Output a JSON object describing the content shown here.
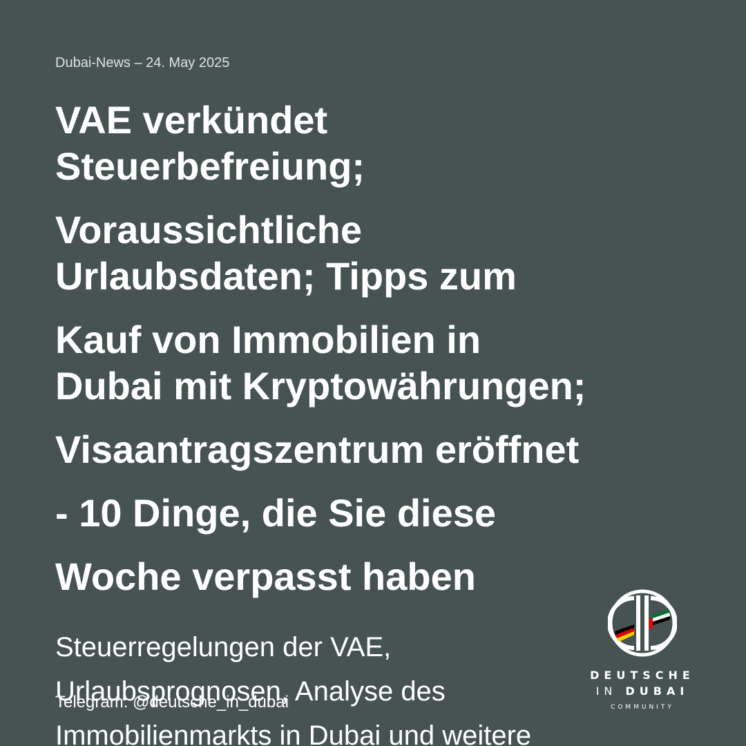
{
  "dateline": "Dubai-News – 24. May 2025",
  "headline": {
    "lines": [
      "VAE verkündet",
      "Steuerbefreiung;",
      "Voraussichtliche",
      "Urlaubsdaten; Tipps zum",
      "Kauf von Immobilien in",
      "Dubai mit Kryptowährungen;",
      "Visaantragszentrum eröffnet",
      "- 10 Dinge, die Sie diese",
      "Woche verpasst haben"
    ]
  },
  "subtitle": {
    "lines": [
      "Steuerregelungen der VAE,",
      "Urlaubsprognosen, Analyse des",
      "Immobilienmarkts in Dubai und weitere"
    ]
  },
  "telegram": "Telegram: @deutsche_in_dubai",
  "logo": {
    "line1": "DEUTSCHE",
    "line2_prefix": "IN ",
    "line2_bold": "DUBAI",
    "line3": "COMMUNITY",
    "icon": "dd-monogram-flags-icon"
  },
  "colors": {
    "background": "#475353",
    "text": "#ffffff",
    "flag_black": "#000000",
    "flag_red": "#dd0000",
    "flag_gold": "#ffce00",
    "uae_green": "#00732f",
    "uae_red": "#ff0000"
  }
}
